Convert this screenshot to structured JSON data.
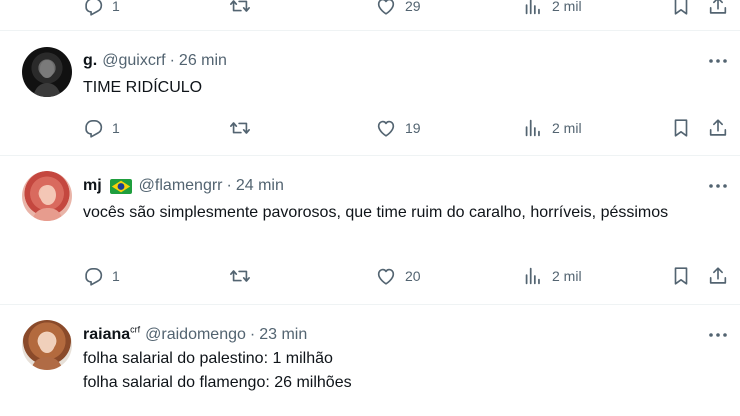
{
  "tweets": [
    {
      "stats": {
        "replies": "1",
        "retweets": "",
        "likes": "29",
        "views": "2 mil"
      }
    },
    {
      "name": "g.",
      "handle": "@guixcrf",
      "time": "26 min",
      "text": "TIME RIDÍCULO",
      "stats": {
        "replies": "1",
        "retweets": "",
        "likes": "19",
        "views": "2 mil"
      }
    },
    {
      "name": "mj",
      "handle": "@flamengrr",
      "time": "24 min",
      "text": "vocês são simplesmente pavorosos, que time ruim do caralho, horríveis, péssimos",
      "stats": {
        "replies": "1",
        "retweets": "",
        "likes": "20",
        "views": "2 mil"
      }
    },
    {
      "name": "raiana",
      "name_sup": "crf",
      "handle": "@raidomengo",
      "time": "23 min",
      "text_lines": [
        "folha salarial do palestino: 1 milhão",
        "folha salarial do flamengo: 26 milhões"
      ]
    }
  ],
  "separator": "·",
  "icons": {
    "reply": "reply-icon",
    "retweet": "retweet-icon",
    "like": "heart-icon",
    "views": "views-icon",
    "bookmark": "bookmark-icon",
    "share": "share-icon",
    "more": "more-icon",
    "flag": "brazil-flag-icon"
  },
  "colors": {
    "text": "#0f1419",
    "muted": "#536471",
    "divider": "#eff3f4"
  }
}
